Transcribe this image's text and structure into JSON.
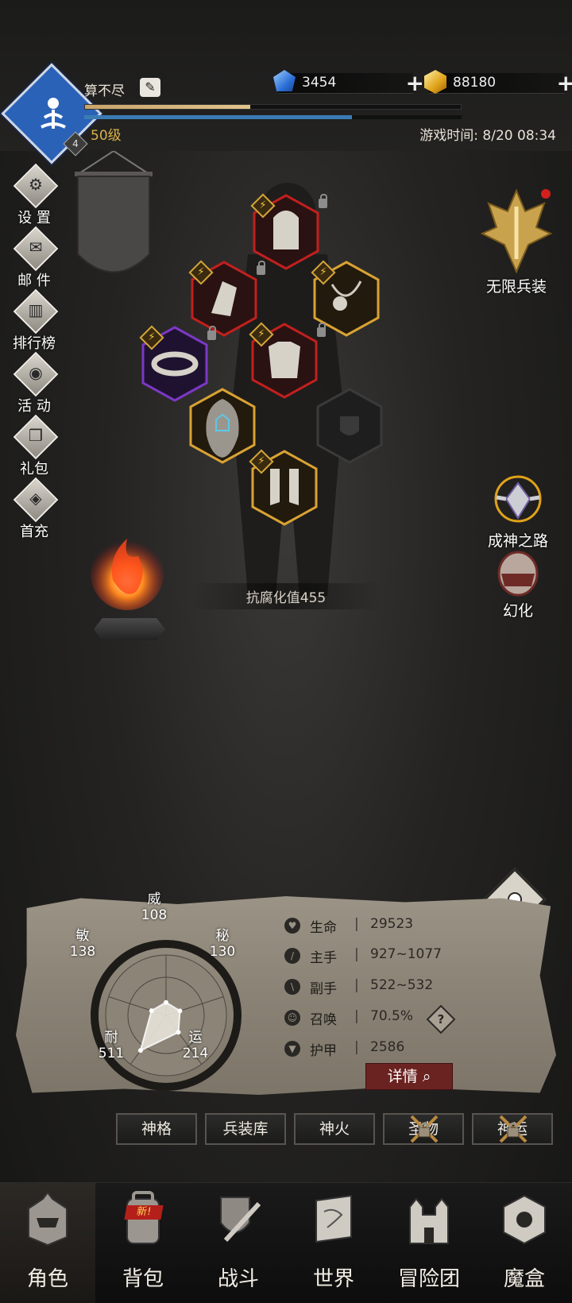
{
  "player": {
    "name": "算不尽",
    "level_text": "50级",
    "rank_badge": "4",
    "xp_progress": 0.44,
    "mp_progress": 0.71
  },
  "currencies": [
    {
      "icon": "blue-gem-icon",
      "value": "3454",
      "plus": "+"
    },
    {
      "icon": "gold-crystal-icon",
      "value": "88180",
      "plus": "+"
    }
  ],
  "game_time": "游戏时间: 8/20 08:34",
  "side_menu": [
    {
      "id": "settings",
      "label": "设 置",
      "icon": "gear-icon"
    },
    {
      "id": "mail",
      "label": "邮 件",
      "icon": "mail-icon"
    },
    {
      "id": "ranking",
      "label": "排行榜",
      "icon": "ranking-icon"
    },
    {
      "id": "events",
      "label": "活 动",
      "icon": "event-icon"
    },
    {
      "id": "gift",
      "label": "礼包",
      "icon": "gift-icon"
    },
    {
      "id": "first-charge",
      "label": "首充",
      "icon": "first-charge-icon"
    }
  ],
  "right_features": {
    "infinite_arms": "无限兵装",
    "path_to_god": "成神之路",
    "transform": "幻化"
  },
  "corruption_text": "抗腐化值455",
  "attributes": [
    {
      "name": "威",
      "value": "108"
    },
    {
      "name": "秘",
      "value": "130"
    },
    {
      "name": "运",
      "value": "214"
    },
    {
      "name": "耐",
      "value": "511"
    },
    {
      "name": "敏",
      "value": "138"
    }
  ],
  "stats": [
    {
      "icon": "heart-icon",
      "label": "生命",
      "sep": "|",
      "value": "29523"
    },
    {
      "icon": "sword-icon",
      "label": "主手",
      "sep": "|",
      "value": "927~1077"
    },
    {
      "icon": "offhand-icon",
      "label": "副手",
      "sep": "|",
      "value": "522~532"
    },
    {
      "icon": "summon-icon",
      "label": "召唤",
      "sep": "|",
      "value": "70.5%"
    },
    {
      "icon": "armor-icon",
      "label": "护甲",
      "sep": "|",
      "value": "2586"
    }
  ],
  "help_symbol": "?",
  "detail_button": "详情",
  "sub_tabs": [
    {
      "label": "神格",
      "locked": false
    },
    {
      "label": "兵装库",
      "locked": false
    },
    {
      "label": "神火",
      "locked": false
    },
    {
      "label": "圣物",
      "locked": true
    },
    {
      "label": "神运",
      "locked": true
    }
  ],
  "bottom_nav": [
    {
      "label": "角色",
      "icon": "helmet-icon",
      "active": true
    },
    {
      "label": "背包",
      "icon": "backpack-icon",
      "active": false,
      "badge": "新!"
    },
    {
      "label": "战斗",
      "icon": "sword-shield-icon",
      "active": false
    },
    {
      "label": "世界",
      "icon": "map-scroll-icon",
      "active": false
    },
    {
      "label": "冒险团",
      "icon": "castle-icon",
      "active": false
    },
    {
      "label": "魔盒",
      "icon": "magic-box-icon",
      "active": false
    }
  ],
  "colors": {
    "accent_gold": "#d9b34a",
    "xp_bar": "#c9a46a",
    "mp_bar": "#3b7bb4",
    "detail_button": "#6b2321",
    "rarity_red": "#c0201e",
    "rarity_gold": "#d9a233",
    "rarity_purple": "#7b38c4"
  }
}
